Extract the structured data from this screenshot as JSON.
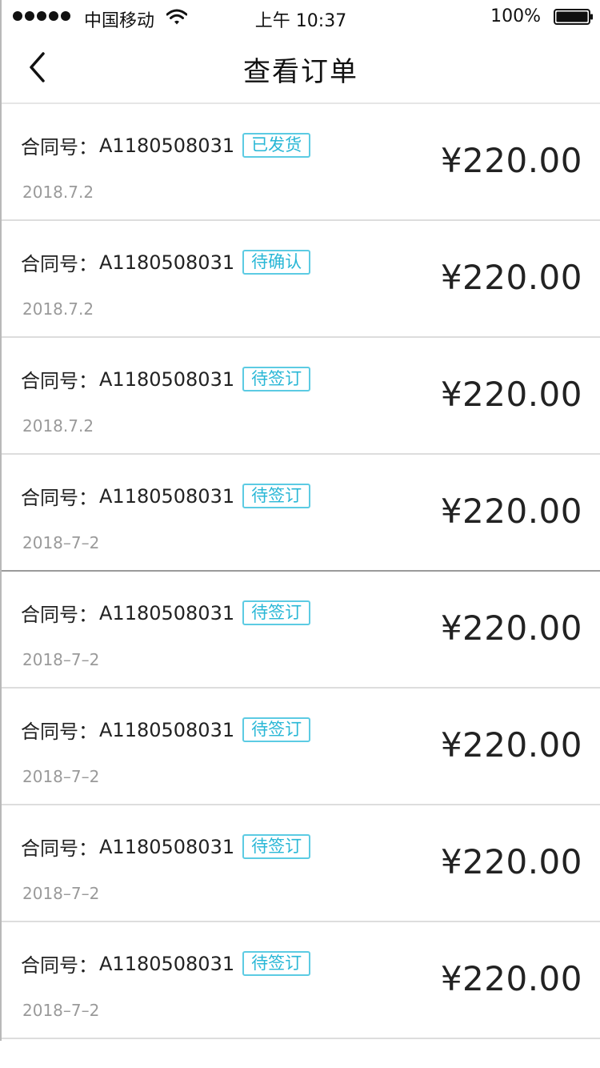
{
  "status_bar": {
    "carrier": "中国移动",
    "time": "上午 10:37",
    "battery": "100%"
  },
  "nav": {
    "title": "查看订单"
  },
  "orders": [
    {
      "label": "合同号：",
      "contract_no": "A1180508031",
      "status": "已发货",
      "date": "2018.7.2",
      "price": "¥220.00"
    },
    {
      "label": "合同号：",
      "contract_no": "A1180508031",
      "status": "待确认",
      "date": "2018.7.2",
      "price": "¥220.00"
    },
    {
      "label": "合同号：",
      "contract_no": "A1180508031",
      "status": "待签订",
      "date": "2018.7.2",
      "price": "¥220.00"
    },
    {
      "label": "合同号：",
      "contract_no": "A1180508031",
      "status": "待签订",
      "date": "2018–7–2",
      "price": "¥220.00"
    },
    {
      "label": "合同号：",
      "contract_no": "A1180508031",
      "status": "待签订",
      "date": "2018–7–2",
      "price": "¥220.00"
    },
    {
      "label": "合同号：",
      "contract_no": "A1180508031",
      "status": "待签订",
      "date": "2018–7–2",
      "price": "¥220.00"
    },
    {
      "label": "合同号：",
      "contract_no": "A1180508031",
      "status": "待签订",
      "date": "2018–7–2",
      "price": "¥220.00"
    },
    {
      "label": "合同号：",
      "contract_no": "A1180508031",
      "status": "待签订",
      "date": "2018–7–2",
      "price": "¥220.00"
    }
  ],
  "colors": {
    "accent": "#29b7d6",
    "tag_border": "#5ccbe3",
    "muted": "#9a9a9a"
  },
  "icons": {
    "back": "chevron-left-icon",
    "wifi": "wifi-icon",
    "battery": "battery-icon",
    "signal": "signal-dots-icon"
  }
}
